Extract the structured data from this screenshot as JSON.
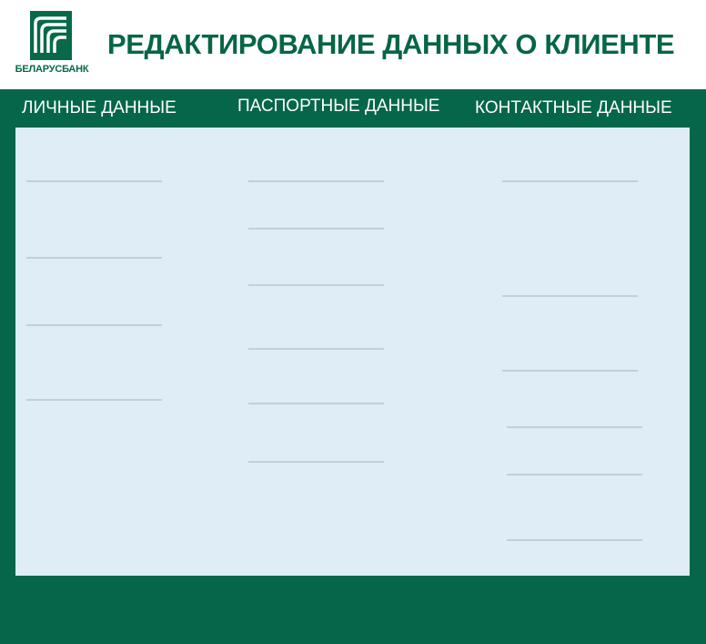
{
  "brand": {
    "name": "БЕЛАРУСБАНК",
    "color": "#08694a"
  },
  "header": {
    "title": "РЕДАКТИРОВАНИЕ ДАННЫХ О КЛИЕНТЕ"
  },
  "sections": {
    "personal": {
      "heading": "ЛИЧНЫЕ ДАННЫЕ",
      "field_count": 4
    },
    "passport": {
      "heading": "ПАСПОРТНЫЕ ДАННЫЕ",
      "field_count": 6
    },
    "contact": {
      "heading": "КОНТАКТНЫЕ ДАННЫЕ",
      "field_count": 6
    }
  },
  "colors": {
    "primary_green": "#05664a",
    "panel_background": "#deedf6",
    "field_underline": "#c6cfd4",
    "heading_text": "#ffffff"
  }
}
